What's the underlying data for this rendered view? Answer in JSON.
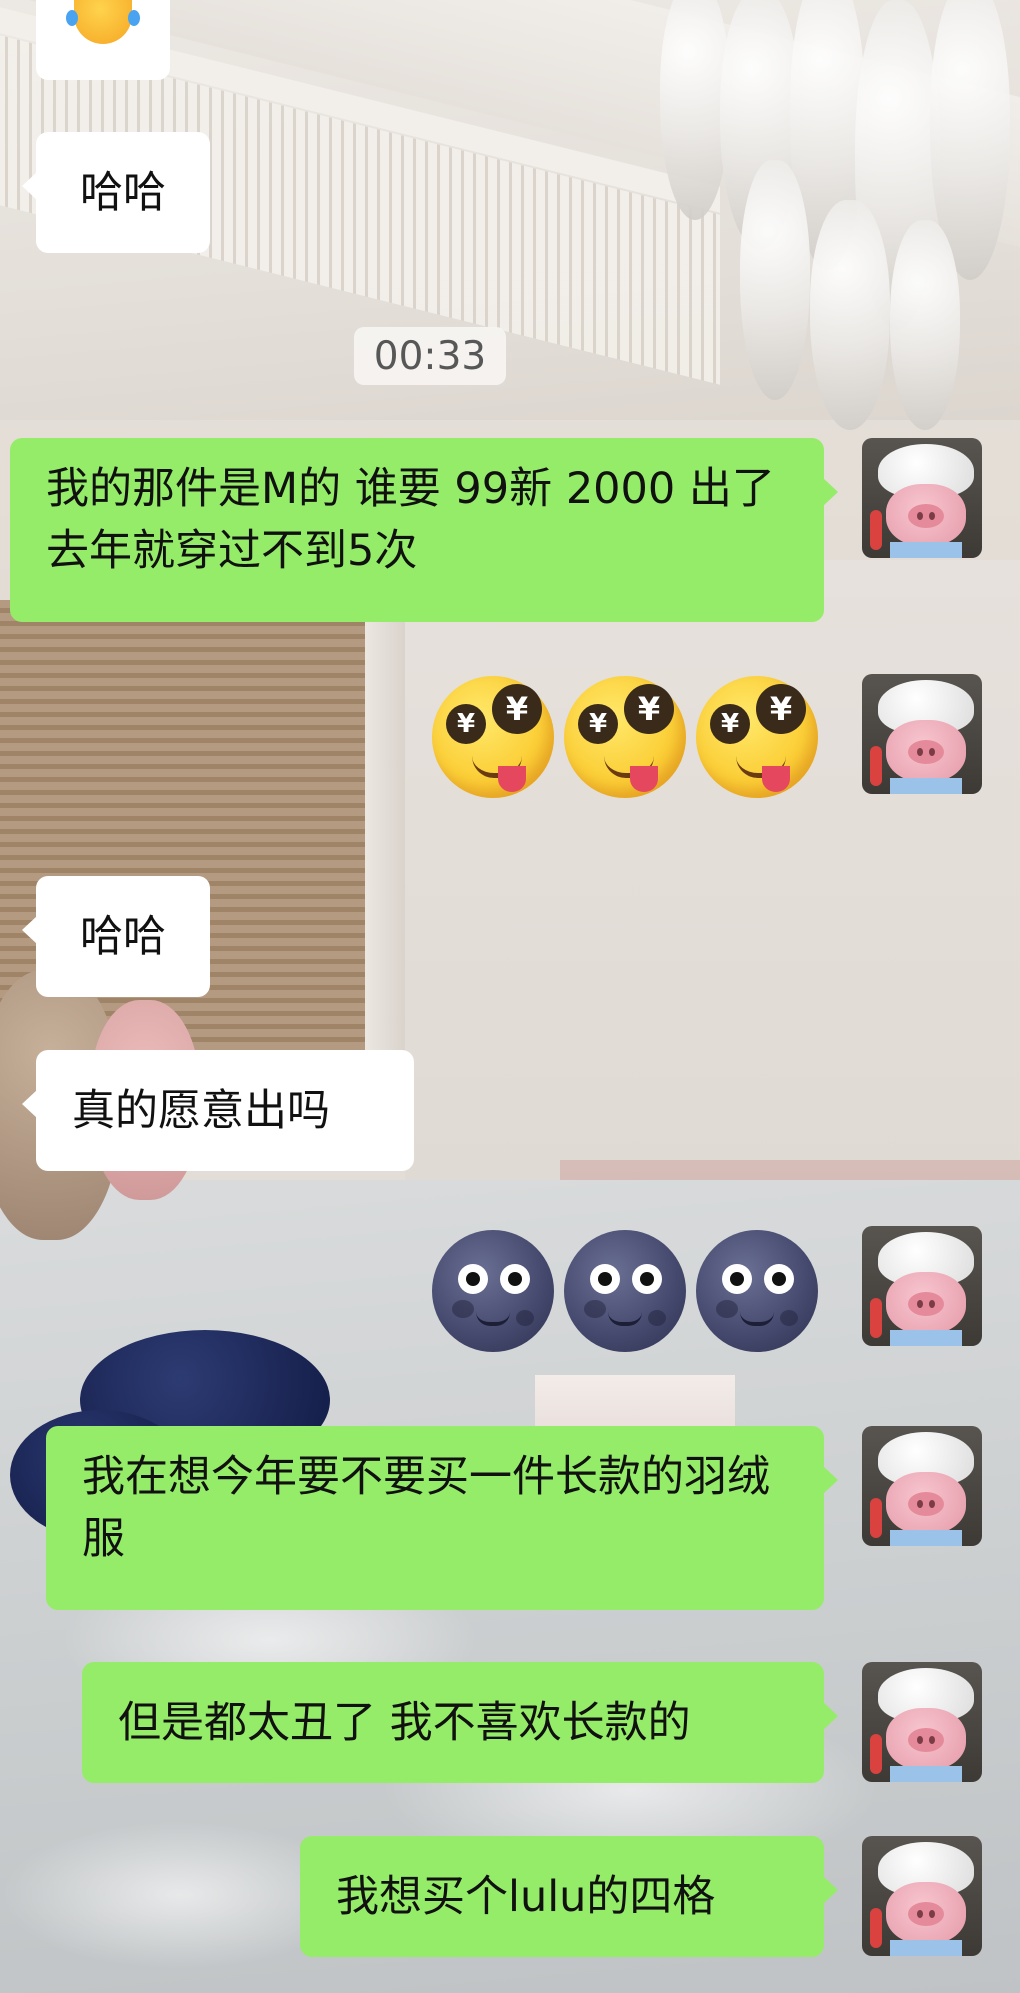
{
  "chat": {
    "timestamp": "00:33",
    "messages": [
      {
        "sender": "other",
        "type": "emoji",
        "emoji": "laughing-crying"
      },
      {
        "sender": "other",
        "type": "text",
        "text": "哈哈"
      },
      {
        "sender": "me",
        "type": "text",
        "text": "我的那件是M的 谁要 99新 2000 出了 去年就穿过不到5次"
      },
      {
        "sender": "me",
        "type": "emoji",
        "emoji": "money-eyes-tongue-emoji",
        "count": 3
      },
      {
        "sender": "other",
        "type": "text",
        "text": "哈哈"
      },
      {
        "sender": "other",
        "type": "text",
        "text": "真的愿意出吗"
      },
      {
        "sender": "me",
        "type": "emoji",
        "emoji": "new-moon-face-emoji",
        "count": 3
      },
      {
        "sender": "me",
        "type": "text",
        "text": "我在想今年要不要买一件长款的羽绒服"
      },
      {
        "sender": "me",
        "type": "text",
        "text": "但是都太丑了 我不喜欢长款的"
      },
      {
        "sender": "me",
        "type": "text",
        "text": "我想买个lulu的四格"
      }
    ]
  },
  "avatar": {
    "icon": "pig-chef-avatar"
  },
  "colors": {
    "my_bubble": "#95ec69",
    "other_bubble": "#ffffff",
    "timestamp_bg": "#f6f4f1",
    "timestamp_text": "#575757"
  }
}
